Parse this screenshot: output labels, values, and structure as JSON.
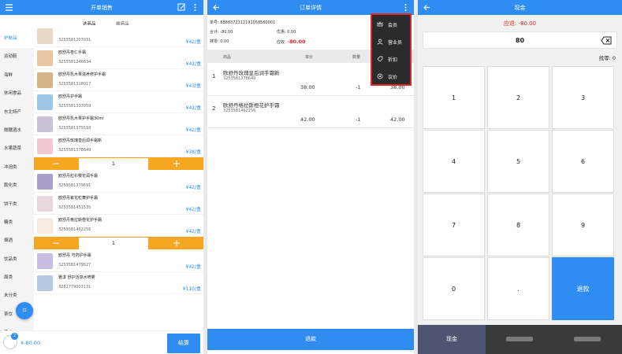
{
  "sale_panel": {
    "title": "开单销售",
    "tabs": [
      "选商品",
      "选商品"
    ],
    "tab_labels": {
      "first": "选商品",
      "second": "维商品"
    },
    "categories": [
      "护肤品",
      "运动鞋",
      "海鲜",
      "休闲食品",
      "东北特产",
      "微醺酒水",
      "水果蔬菜",
      "冲泡类",
      "膨化类",
      "饼干类",
      "糖类",
      "烟酒",
      "饮品类",
      "面类",
      "未分类",
      "茶饮",
      "其它"
    ],
    "active_category": "护肤品",
    "products": [
      {
        "name": "",
        "code": "3253581207031",
        "price": "¥42/盒"
      },
      {
        "name": "欧舒丹杏仁手霜",
        "code": "3253581246634",
        "price": "¥42/盒"
      },
      {
        "name": "欧舒丹乳木果滋养修护手霜",
        "code": "3253581318017",
        "price": "¥43/盒"
      },
      {
        "name": "欧舒丹护手霜",
        "code": "3253581337059",
        "price": "¥42/盒"
      },
      {
        "name": "欧舒丹乳木果护手霜30ml",
        "code": "3253581375518",
        "price": "¥42/盒"
      },
      {
        "name": "欧舒丹玫瑰皇后润手霜新",
        "code": "3253581378649",
        "price": "¥38/盒",
        "qty": "1"
      },
      {
        "name": "欧舒丹粒衫樱花润手霜",
        "code": "3253581379691",
        "price": "¥42/盒"
      },
      {
        "name": "欧舒丹紫花粒舞护手霜",
        "code": "3253581451535",
        "price": "¥42/盒"
      },
      {
        "name": "欧舒丹格拉斯橙花护手霜",
        "code": "3253581462256",
        "price": "¥42/盒",
        "qty": "1"
      },
      {
        "name": "欧舒丹 芍药护手霜",
        "code": "3253581479627",
        "price": "¥42/盒"
      },
      {
        "name": "雅漾 舒护活泉水喷雾",
        "code": "3282779003131",
        "price": "¥110/盒"
      }
    ],
    "cart_count": "2",
    "total": "¥-80.00",
    "checkout_label": "结算"
  },
  "order_panel": {
    "title": "订单详情",
    "order_no": "单号: 8888372312191058560001",
    "subtotal": "合计: -80.00",
    "discount": "优惠: 0.00",
    "zero": "抹零: 0.00",
    "receivable_label": "应收: ",
    "receivable_value": "-80.00",
    "columns": {
      "name": "商品",
      "price": "单价",
      "qty": "数量",
      "amount": "小计"
    },
    "items": [
      {
        "idx": "1",
        "name": "欧舒丹玫瑰皇后润手霜新",
        "code": "3253581378649",
        "price": "38.00",
        "qty": "-1",
        "amount": "38.00"
      },
      {
        "idx": "2",
        "name": "欧舒丹格拉斯橙花护手霜",
        "code": "3253581462256",
        "price": "42.00",
        "qty": "-1",
        "amount": "42.00"
      }
    ],
    "menu": [
      "会员",
      "营业员",
      "折扣",
      "议价"
    ],
    "refund_label": "退款"
  },
  "cash_panel": {
    "title": "现金",
    "due": "应退: -80.00",
    "amount": "80",
    "change": "找零: 0",
    "keys": [
      "1",
      "2",
      "3",
      "4",
      "5",
      "6",
      "7",
      "8",
      "9",
      "0",
      "."
    ],
    "refund_key": "退款",
    "pay_tabs": [
      "现金"
    ]
  },
  "colors": {
    "accent": "#2f8cf0",
    "warn": "#f5a623",
    "red": "#e02828"
  }
}
